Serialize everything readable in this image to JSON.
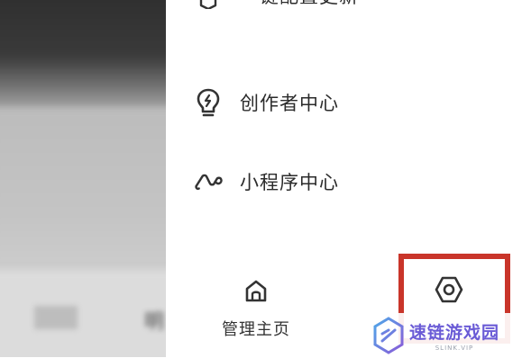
{
  "drawer": {
    "cut_item_label": "一键配置更新",
    "items": [
      {
        "icon": "lightbulb-icon",
        "label": "创作者中心"
      },
      {
        "icon": "mini-program-icon",
        "label": "小程序中心"
      }
    ]
  },
  "bottom_bar": {
    "home_label": "管理主页",
    "settings_icon": "gear-icon"
  },
  "background": {
    "blurred_text": "明"
  },
  "watermark": {
    "title": "速链游戏园",
    "subtitle": "SLINK.VIP"
  },
  "colors": {
    "highlight": "#c9352a",
    "watermark_brand": "#6a5bd6"
  }
}
